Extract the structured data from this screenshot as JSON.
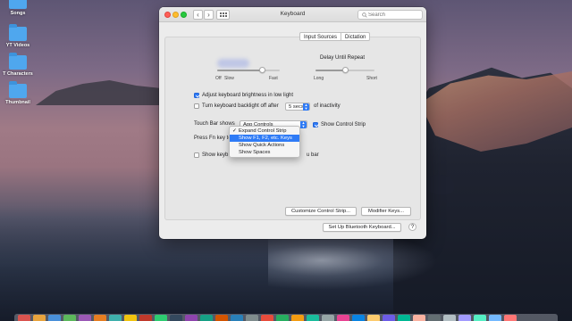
{
  "desktop": {
    "items": [
      {
        "label": "Songs"
      },
      {
        "label": "YT Videos"
      },
      {
        "label": "T Characters"
      },
      {
        "label": "Thumbnail"
      }
    ]
  },
  "window": {
    "title": "Keyboard",
    "search_placeholder": "Search",
    "tabs": [
      "Input Sources",
      "Dictation"
    ],
    "key_repeat": {
      "min_label": "Off",
      "slow_label": "Slow",
      "max_label": "Fast",
      "value": 0.72
    },
    "delay_until_repeat": {
      "label": "Delay Until Repeat",
      "min_label": "Long",
      "max_label": "Short",
      "value": 0.5
    },
    "adjust_brightness": {
      "label": "Adjust keyboard brightness in low light",
      "checked": true
    },
    "backlight_off": {
      "label": "Turn keyboard backlight off after",
      "checked": false,
      "duration": "5 secs",
      "suffix": "of inactivity"
    },
    "touch_bar": {
      "label": "Touch Bar shows",
      "value": "App Controls",
      "show_control_strip_label": "Show Control Strip",
      "show_control_strip_checked": true
    },
    "fn_key": {
      "label": "Press Fn key to",
      "menu_options": [
        {
          "label": "Expand Control Strip",
          "checked": true,
          "highlighted": false
        },
        {
          "label": "Show F1, F2, etc. Keys",
          "checked": false,
          "highlighted": true
        },
        {
          "label": "Show Quick Actions",
          "checked": false,
          "highlighted": false
        },
        {
          "label": "Show Spaces",
          "checked": false,
          "highlighted": false
        }
      ]
    },
    "show_viewers": {
      "label_left": "Show keyb",
      "label_right": "u bar",
      "checked": false
    },
    "buttons": {
      "customize": "Customize Control Strip...",
      "modifier": "Modifier Keys...",
      "bluetooth": "Set Up Bluetooth Keyboard...",
      "help": "?"
    }
  },
  "colors": {
    "accent": "#2f7bf6",
    "close": "#ff5f57",
    "minimize": "#ffbd2e",
    "zoom": "#28c940"
  },
  "dock": {
    "apps": [
      "#d9534f",
      "#e8a33d",
      "#4a90d9",
      "#5cb85c",
      "#9b59b6",
      "#e67e22",
      "#3fb0ac",
      "#f1c40f",
      "#c0392b",
      "#2ecc71",
      "#34495e",
      "#8e44ad",
      "#16a085",
      "#d35400",
      "#2980b9",
      "#7f8c8d",
      "#e74c3c",
      "#27ae60",
      "#f39c12",
      "#1abc9c",
      "#95a5a6",
      "#e84393",
      "#0984e3",
      "#fdcb6e",
      "#6c5ce7",
      "#00b894",
      "#fab1a0",
      "#636e72",
      "#b2bec3",
      "#a29bfe",
      "#55efc4",
      "#74b9ff",
      "#ff7675"
    ]
  }
}
